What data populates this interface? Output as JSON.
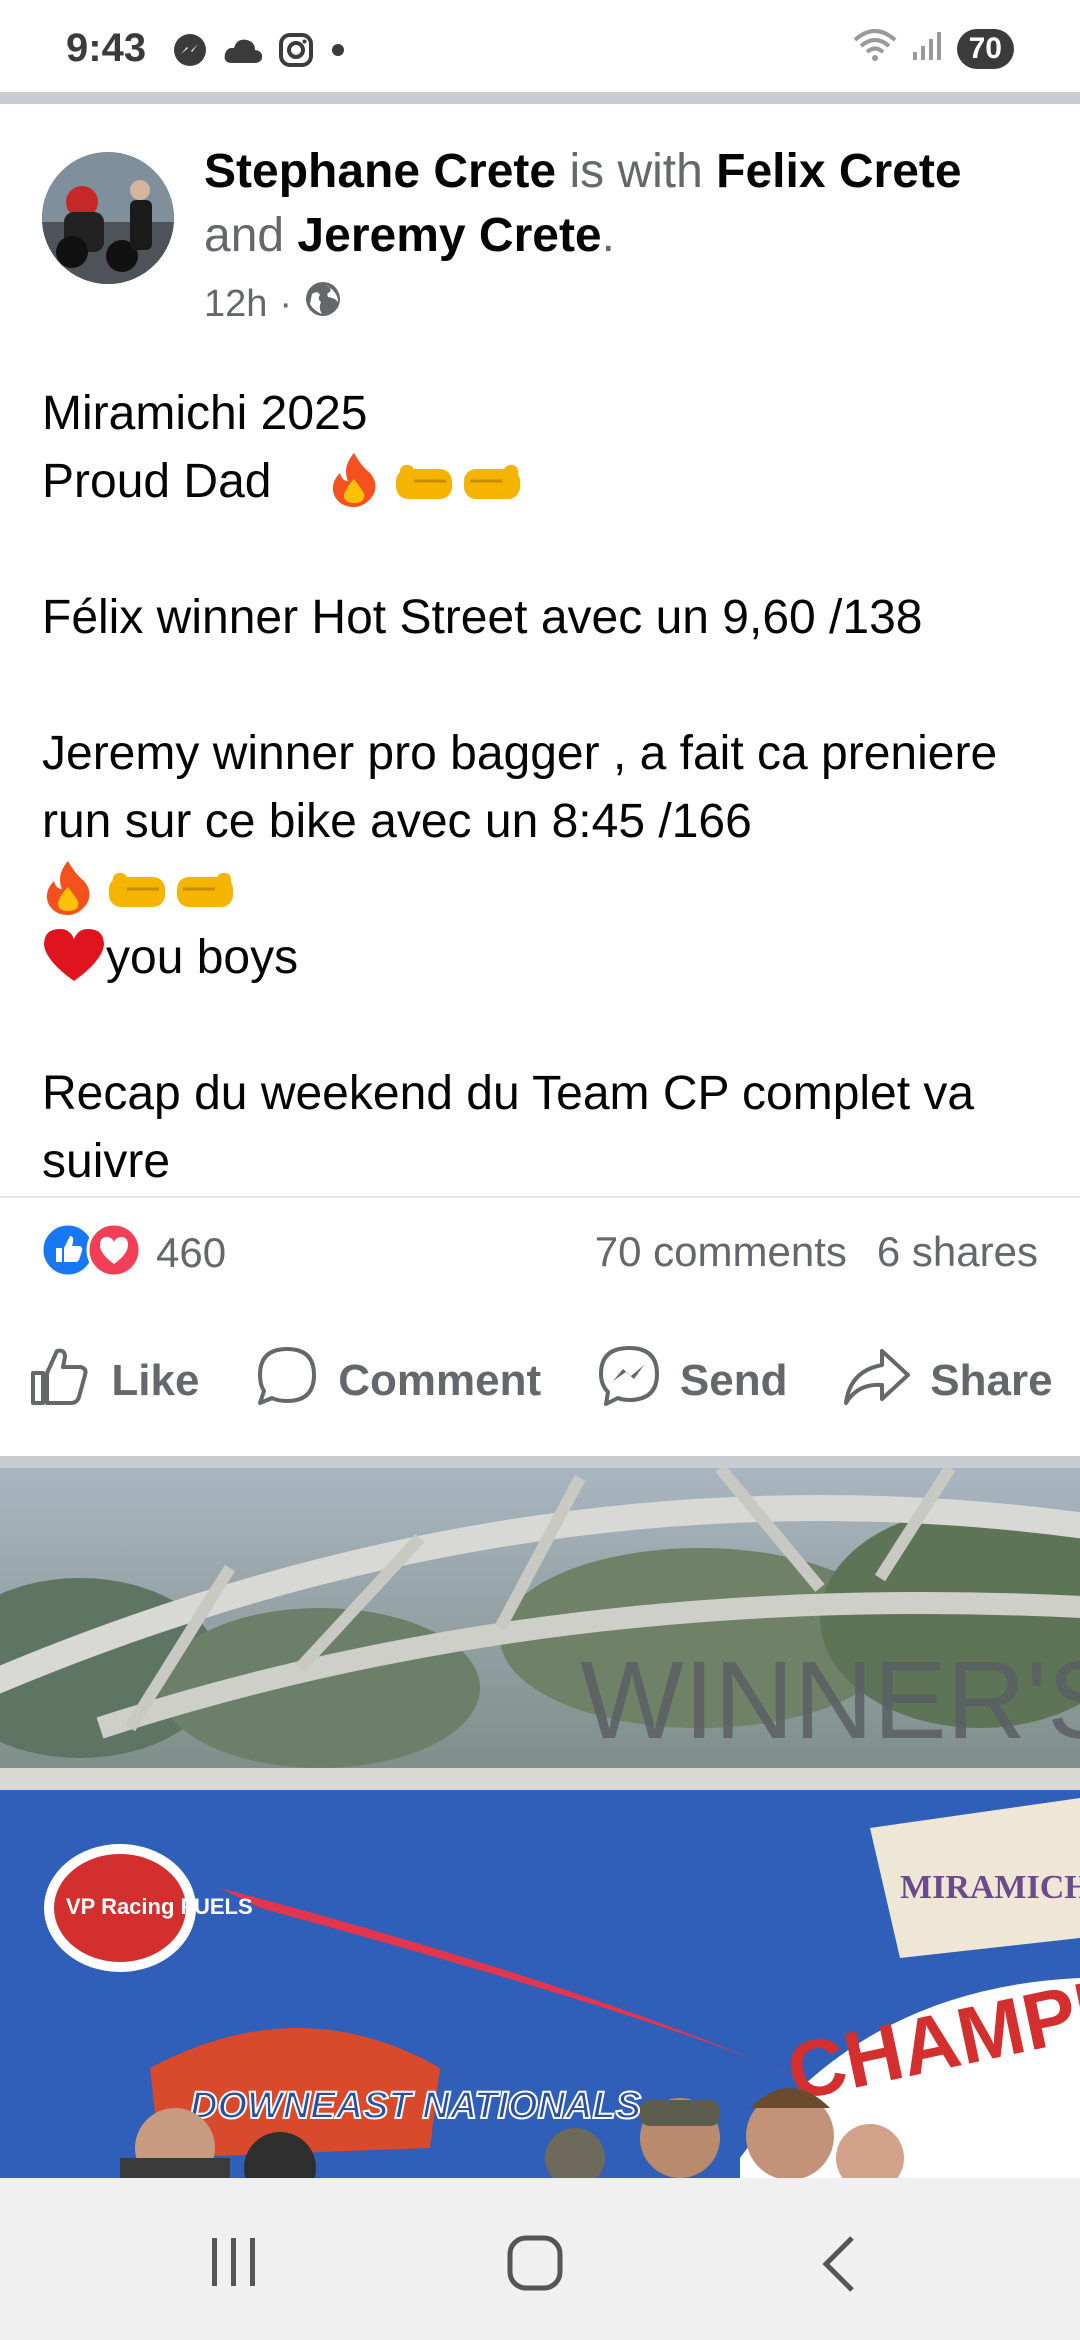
{
  "status_bar": {
    "time": "9:43",
    "battery": "70",
    "icons": [
      "messenger-icon",
      "cloud-icon",
      "instagram-icon",
      "dot-icon",
      "wifi-icon",
      "signal-icon"
    ]
  },
  "post": {
    "author": "Stephane Crete",
    "with_text": " is with ",
    "tagged_1": "Felix Crete",
    "and_text": " and ",
    "tagged_2": "Jeremy Crete",
    "period": ".",
    "time": "12h",
    "dot": " · ",
    "privacy_icon": "globe-icon",
    "text": {
      "line1": "Miramichi 2025",
      "line2": "Proud Dad",
      "line3": "Félix winner Hot Street avec un 9,60 /138",
      "line4": "Jeremy winner pro bagger , a fait ca preniere run sur ce bike avec un 8:45 /166",
      "line6": "you boys",
      "line7": "Recap du weekend du Team CP complet va suivre"
    }
  },
  "engagement": {
    "reaction_count": "460",
    "comments": "70 comments",
    "shares": "6 shares"
  },
  "actions": {
    "like": "Like",
    "comment": "Comment",
    "send": "Send",
    "share": "Share"
  },
  "photo": {
    "arch_text": "WINNER'S",
    "sponsor_left": "VP Racing FUELS",
    "event_logo": "DOWNEAST NATIONALS",
    "track_logo": "MIRAMICHI DRAGWAY",
    "banner_text": "CHAMPIO"
  },
  "colors": {
    "accent_blue": "#1877f2",
    "love_red": "#f33e58",
    "gray_text": "#65676b",
    "banner_blue": "#2f5fb8"
  }
}
